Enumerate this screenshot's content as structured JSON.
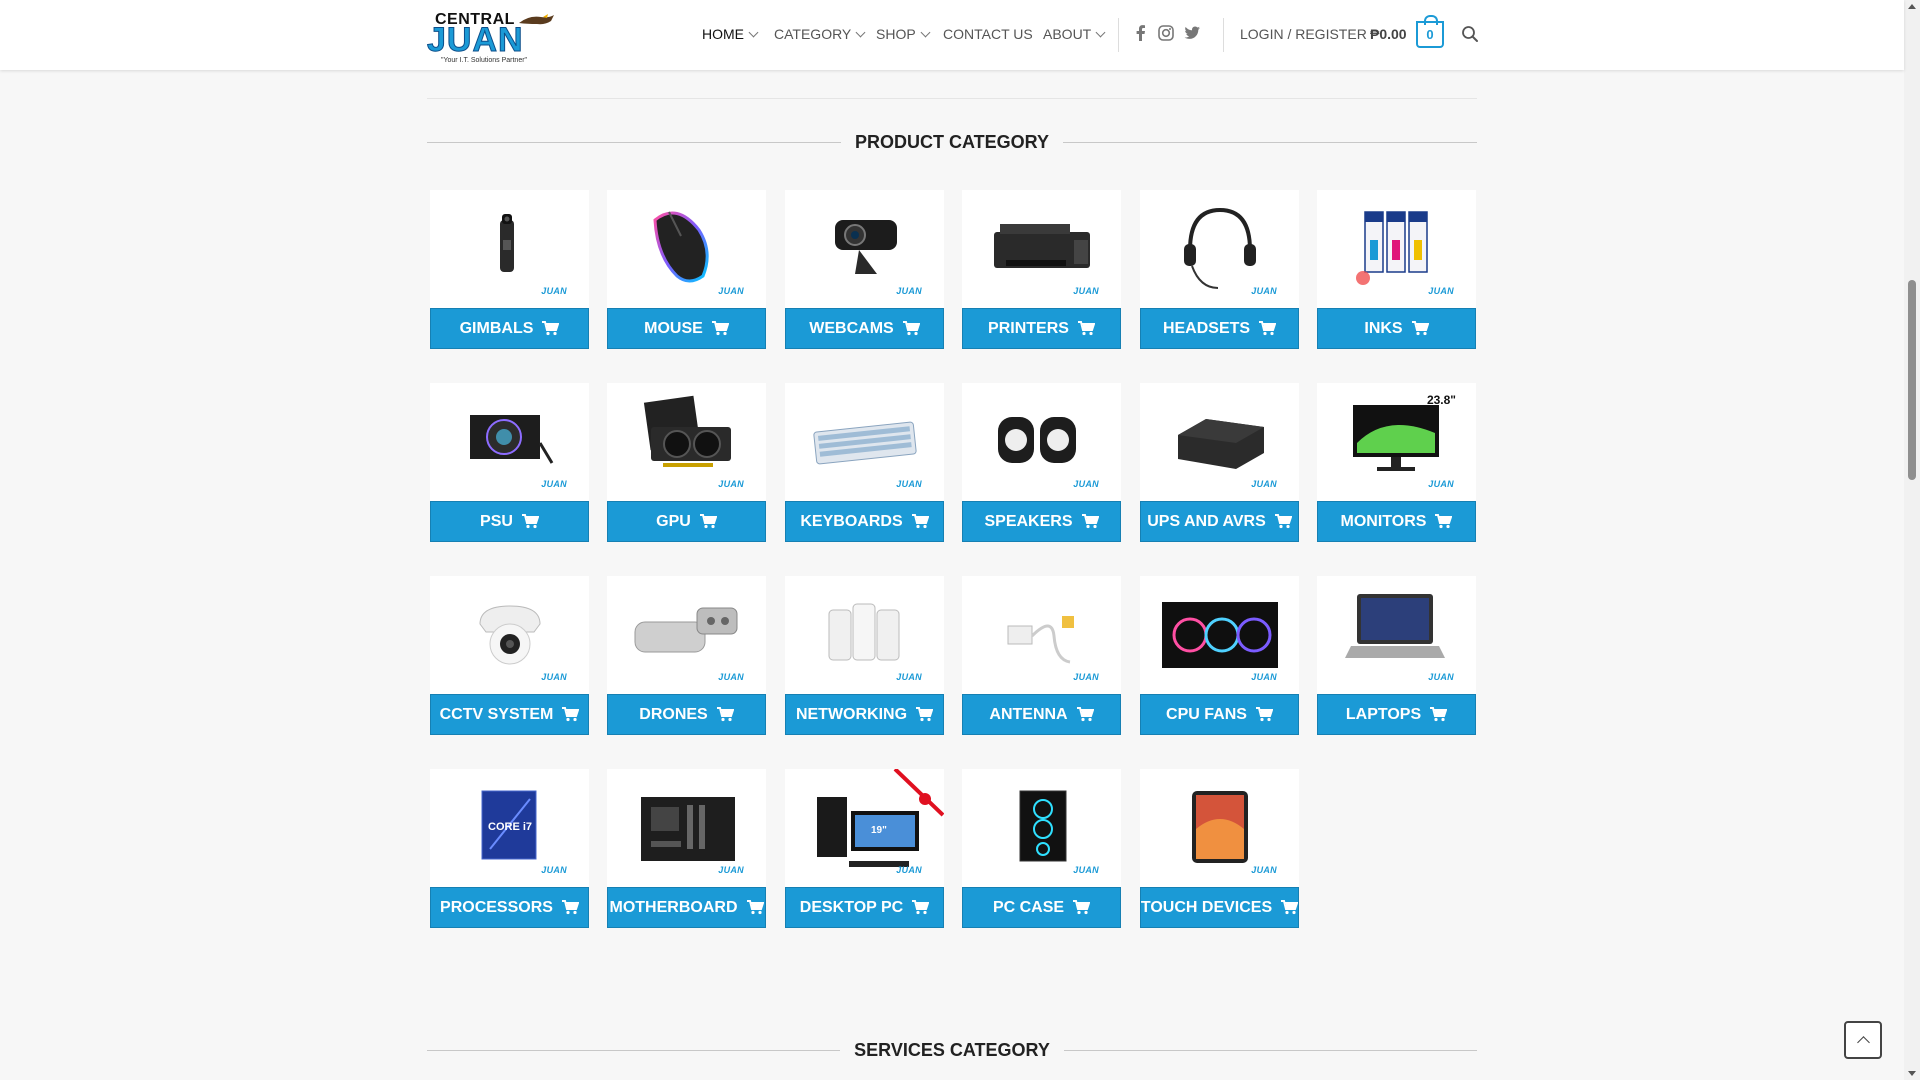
{
  "logo": {
    "line1": "CENTRAL",
    "line2": "JUAN",
    "tagline": "\"Your I.T. Solutions Partner\""
  },
  "nav": {
    "items": [
      {
        "label": "HOME",
        "dropdown": true,
        "active": true
      },
      {
        "label": "CATEGORY",
        "dropdown": true
      },
      {
        "label": "SHOP",
        "dropdown": true
      },
      {
        "label": "CONTACT US",
        "dropdown": false
      },
      {
        "label": "ABOUT",
        "dropdown": true
      }
    ],
    "social_icons": [
      "facebook-icon",
      "instagram-icon",
      "twitter-icon"
    ],
    "login_label": "LOGIN / REGISTER",
    "cart_total": "₱0.00",
    "cart_count": "0"
  },
  "product_section": {
    "title": "PRODUCT CATEGORY"
  },
  "services_section": {
    "title": "SERVICES CATEGORY"
  },
  "watermark": "JUAN",
  "categories": [
    {
      "label": "GIMBALS",
      "icon": "gimbal-image"
    },
    {
      "label": "MOUSE",
      "icon": "mouse-image"
    },
    {
      "label": "WEBCAMS",
      "icon": "webcam-image"
    },
    {
      "label": "PRINTERS",
      "icon": "printer-image"
    },
    {
      "label": "HEADSETS",
      "icon": "headset-image"
    },
    {
      "label": "INKS",
      "icon": "ink-bottles-image"
    },
    {
      "label": "PSU",
      "icon": "psu-image"
    },
    {
      "label": "GPU",
      "icon": "gpu-image"
    },
    {
      "label": "KEYBOARDS",
      "icon": "keyboard-image"
    },
    {
      "label": "SPEAKERS",
      "icon": "speakers-image"
    },
    {
      "label": "UPS AND AVRS",
      "icon": "ups-image"
    },
    {
      "label": "MONITORS",
      "icon": "monitor-image",
      "badge": "23.8\""
    },
    {
      "label": "CCTV SYSTEM",
      "icon": "cctv-image"
    },
    {
      "label": "DRONES",
      "icon": "drone-image"
    },
    {
      "label": "NETWORKING",
      "icon": "mesh-router-image"
    },
    {
      "label": "ANTENNA",
      "icon": "antenna-image"
    },
    {
      "label": "CPU FANS",
      "icon": "cpu-fans-image"
    },
    {
      "label": "LAPTOPS",
      "icon": "laptop-image"
    },
    {
      "label": "PROCESSORS",
      "icon": "cpu-box-image",
      "box_text": "CORE i7"
    },
    {
      "label": "MOTHERBOARD",
      "icon": "motherboard-image"
    },
    {
      "label": "DESKTOP PC",
      "icon": "desktop-pc-image",
      "screen_text": "19\""
    },
    {
      "label": "PC CASE",
      "icon": "pc-case-image"
    },
    {
      "label": "TOUCH DEVICES",
      "icon": "tablet-image"
    }
  ],
  "colors": {
    "accent": "#1b9ad6",
    "background": "#f7f7f7",
    "header": "#ffffff"
  }
}
